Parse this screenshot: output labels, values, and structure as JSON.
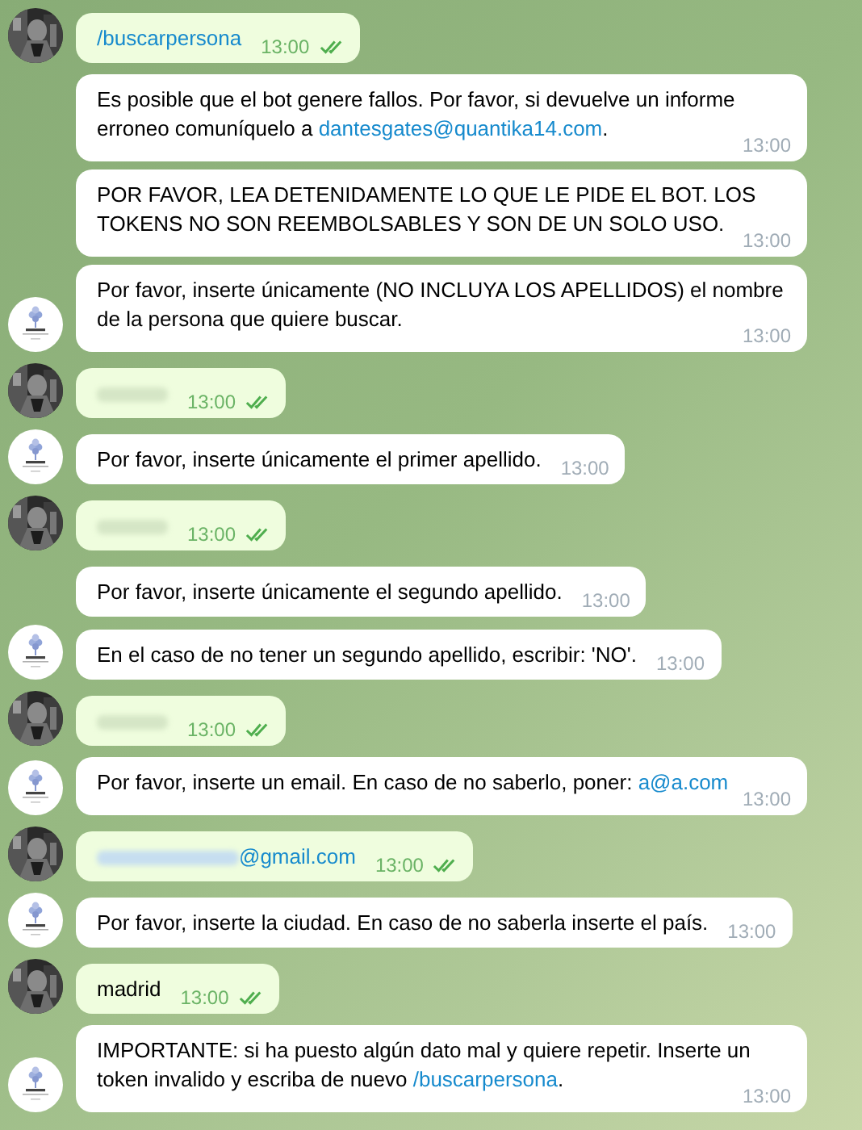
{
  "messages": [
    {
      "kind": "outgoing",
      "avatar": true,
      "parts": [
        {
          "kind": "link",
          "text": "/buscarpersona"
        }
      ],
      "time": "13:00",
      "read": true
    },
    {
      "kind": "incoming",
      "avatar": false,
      "parts": [
        {
          "kind": "text",
          "text": "Es posible que el bot genere fallos. Por favor, si devuelve un informe erroneo comuníquelo a "
        },
        {
          "kind": "link",
          "text": "dantesgates@quantika14.com"
        },
        {
          "kind": "text",
          "text": "."
        }
      ],
      "time": "13:00"
    },
    {
      "kind": "incoming",
      "avatar": false,
      "parts": [
        {
          "kind": "text",
          "text": "POR FAVOR, LEA DETENIDAMENTE LO QUE LE PIDE EL BOT. LOS TOKENS NO SON REEMBOLSABLES Y SON DE UN SOLO USO."
        }
      ],
      "time": "13:00"
    },
    {
      "kind": "incoming",
      "avatar": true,
      "parts": [
        {
          "kind": "text",
          "text": "Por favor, inserte únicamente (NO INCLUYA LOS APELLIDOS) el nombre de la persona que quiere buscar."
        }
      ],
      "time": "13:00"
    },
    {
      "kind": "outgoing",
      "avatar": true,
      "parts": [
        {
          "kind": "redacted"
        }
      ],
      "time": "13:00",
      "read": true
    },
    {
      "kind": "incoming",
      "avatar": true,
      "parts": [
        {
          "kind": "text",
          "text": "Por favor, inserte únicamente el primer apellido."
        }
      ],
      "time": "13:00"
    },
    {
      "kind": "outgoing",
      "avatar": true,
      "parts": [
        {
          "kind": "redacted"
        }
      ],
      "time": "13:00",
      "read": true
    },
    {
      "kind": "incoming",
      "avatar": false,
      "parts": [
        {
          "kind": "text",
          "text": "Por favor, inserte únicamente el segundo apellido."
        }
      ],
      "time": "13:00"
    },
    {
      "kind": "incoming",
      "avatar": true,
      "parts": [
        {
          "kind": "text",
          "text": "En el caso de no tener un segundo apellido, escribir: 'NO'."
        }
      ],
      "time": "13:00"
    },
    {
      "kind": "outgoing",
      "avatar": true,
      "parts": [
        {
          "kind": "redacted"
        }
      ],
      "time": "13:00",
      "read": true
    },
    {
      "kind": "incoming",
      "avatar": true,
      "parts": [
        {
          "kind": "text",
          "text": "Por favor, inserte un email. En caso de no saberlo, poner: "
        },
        {
          "kind": "link",
          "text": "a@a.com"
        }
      ],
      "time": "13:00"
    },
    {
      "kind": "outgoing",
      "avatar": true,
      "parts": [
        {
          "kind": "redacted_link"
        },
        {
          "kind": "link",
          "text": "@gmail.com"
        }
      ],
      "time": "13:00",
      "read": true
    },
    {
      "kind": "incoming",
      "avatar": true,
      "parts": [
        {
          "kind": "text",
          "text": "Por favor, inserte la ciudad. En caso de no saberla inserte el país."
        }
      ],
      "time": "13:00"
    },
    {
      "kind": "outgoing",
      "avatar": true,
      "parts": [
        {
          "kind": "text",
          "text": "madrid"
        }
      ],
      "time": "13:00",
      "read": true
    },
    {
      "kind": "incoming",
      "avatar": true,
      "parts": [
        {
          "kind": "text",
          "text": "IMPORTANTE: si ha puesto algún dato mal y quiere repetir. Inserte un token invalido y escriba de nuevo "
        },
        {
          "kind": "link",
          "text": "/buscarpersona"
        },
        {
          "kind": "text",
          "text": "."
        }
      ],
      "time": "13:00"
    }
  ]
}
